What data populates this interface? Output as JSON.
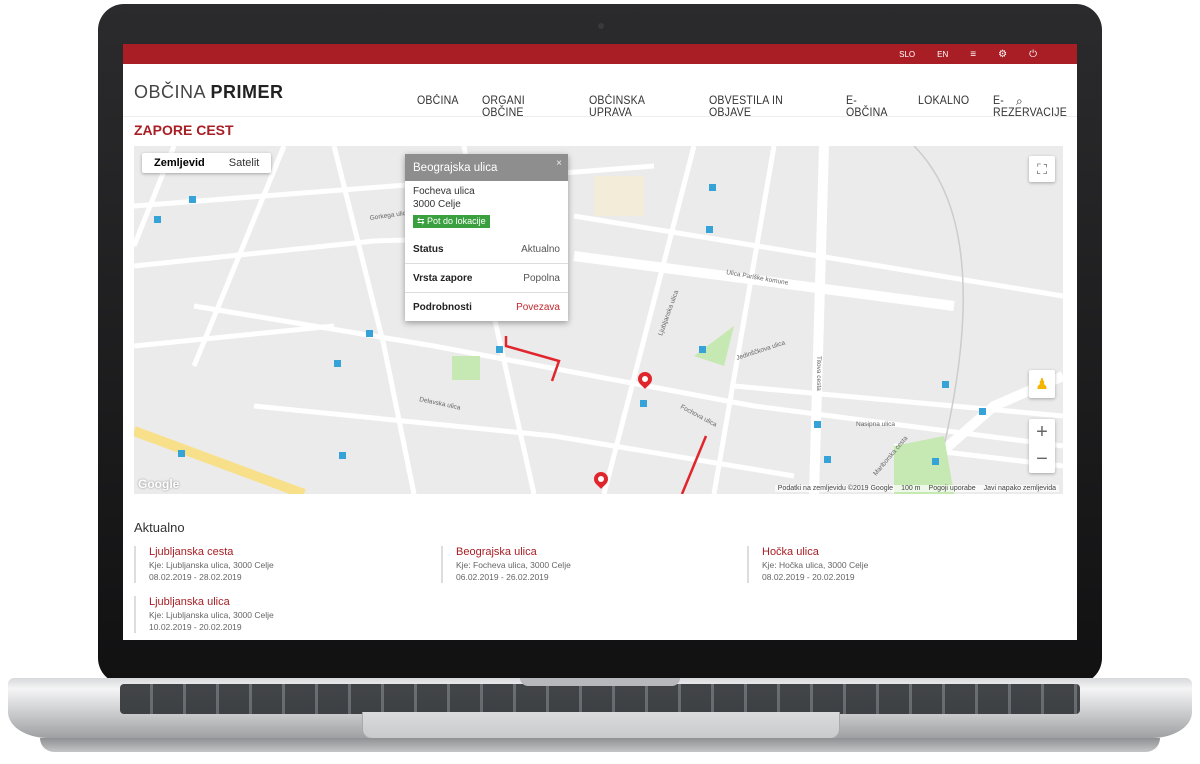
{
  "topbar": {
    "lang_slo": "SLO",
    "lang_en": "EN",
    "menu_icon": "menu-icon",
    "settings_icon": "gear-icon",
    "power_icon": "power-icon"
  },
  "header": {
    "logo_light": "OBČINA ",
    "logo_bold": "PRIMER",
    "nav": [
      "OBČINA",
      "ORGANI OBČINE",
      "OBČINSKA UPRAVA",
      "OBVESTILA IN OBJAVE",
      "E-OBČINA",
      "LOKALNO",
      "E-REZERVACIJE"
    ],
    "search_icon": "search-icon"
  },
  "page_title": "ZAPORE CEST",
  "map": {
    "type_map": "Zemljevid",
    "type_satellite": "Satelit",
    "attribution": "Podatki na zemljevidu ©2019 Google",
    "scale": "100 m",
    "terms": "Pogoji uporabe",
    "report": "Javi napako zemljevida",
    "google": "Google",
    "streets": [
      "Ljubljanska ulica",
      "Ulica Pariške komune",
      "Titova cesta",
      "Fochova ulica",
      "Delavska ulica",
      "Gorkega ulica",
      "Jedinščkova ulica",
      "Nasipna ulica",
      "Mariborska cesta"
    ],
    "infowindow": {
      "title": "Beograjska ulica",
      "close": "×",
      "address_line1": "Focheva ulica",
      "address_line2": "3000 Celje",
      "route_label": "Pot do lokacije",
      "rows": [
        {
          "key": "Status",
          "value": "Aktualno"
        },
        {
          "key": "Vrsta zapore",
          "value": "Popolna"
        },
        {
          "key": "Podrobnosti",
          "value": "Povezava"
        }
      ]
    }
  },
  "current": {
    "title": "Aktualno",
    "items": [
      {
        "name": "Ljubljanska cesta",
        "where": "Kje: Ljubljanska ulica, 3000 Celje",
        "dates": "08.02.2019 - 28.02.2019"
      },
      {
        "name": "Beograjska ulica",
        "where": "Kje: Focheva ulica, 3000 Celje",
        "dates": "06.02.2019 - 26.02.2019"
      },
      {
        "name": "Hočka ulica",
        "where": "Kje: Hočka ulica, 3000 Celje",
        "dates": "08.02.2019 - 20.02.2019"
      },
      {
        "name": "Ljubljanska ulica",
        "where": "Kje: Ljubljanska ulica, 3000 Celje",
        "dates": "10.02.2019 - 20.02.2019"
      }
    ]
  },
  "colors": {
    "brand": "#a81e24",
    "closure": "#e0262c",
    "route_button": "#3aa03f"
  }
}
